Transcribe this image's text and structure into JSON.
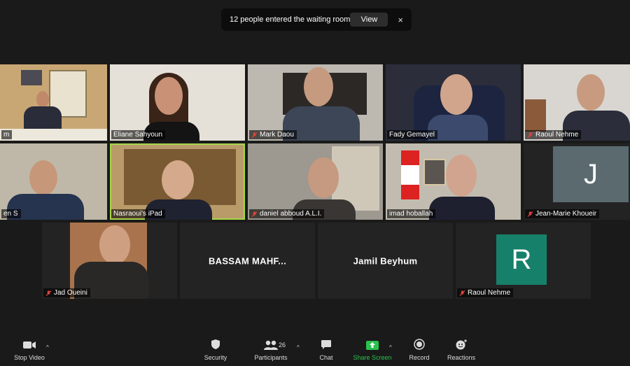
{
  "notification": {
    "text": "12 people entered the waiting room",
    "view_label": "View",
    "close_label": "×"
  },
  "tiles": [
    {
      "name": "m",
      "muted": false
    },
    {
      "name": "Eliane Sahyoun",
      "muted": false
    },
    {
      "name": "Mark Daou",
      "muted": true
    },
    {
      "name": "Fady Gemayel",
      "muted": false
    },
    {
      "name": "Raoul Nehme",
      "muted": true
    },
    {
      "name": "en S",
      "muted": false
    },
    {
      "name": "Nasraoui's iPad",
      "muted": false
    },
    {
      "name": "daniel abboud A.L.I.",
      "muted": true
    },
    {
      "name": "imad hoballah",
      "muted": false
    },
    {
      "name": "Jean-Marie Khoueir",
      "muted": true,
      "initial": "J"
    },
    {
      "name": "Jad Oueini",
      "muted": true
    },
    {
      "name": "BASSAM  MAHF...",
      "muted": false
    },
    {
      "name": "Jamil Beyhum",
      "muted": false
    },
    {
      "name": "Raoul Nehme",
      "muted": true,
      "initial": "R"
    }
  ],
  "toolbar": {
    "stop_video": "Stop Video",
    "security": "Security",
    "participants": "Participants",
    "participants_count": "26",
    "chat": "Chat",
    "share_screen": "Share Screen",
    "record": "Record",
    "reactions": "Reactions",
    "caret": "^"
  },
  "colors": {
    "active_speaker": "#a6d64a",
    "share_green": "#29c24e",
    "avatar_j": "#5a6a6f",
    "avatar_r": "#17806a",
    "mute_red": "#d9453d"
  }
}
